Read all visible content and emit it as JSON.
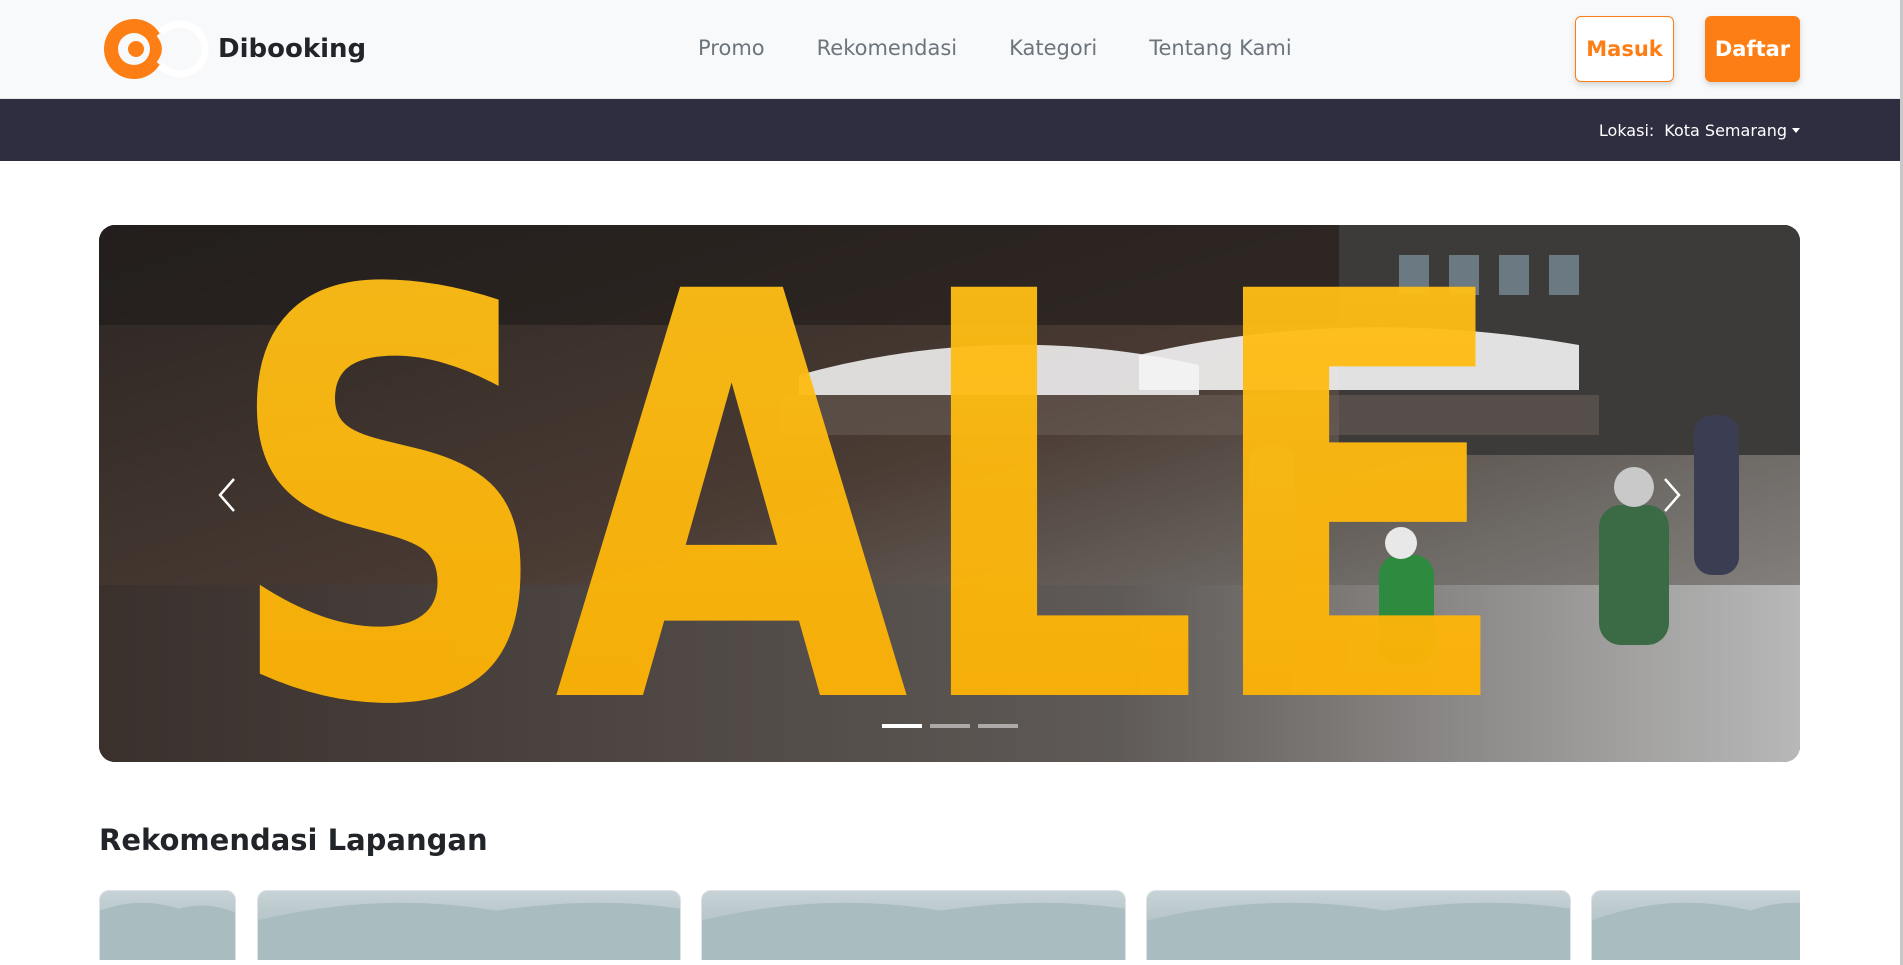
{
  "brand": {
    "name": "Dibooking",
    "logo_icon": "dibooking-logo",
    "accent_color": "#fd7e14"
  },
  "nav": {
    "links": [
      {
        "label": "Promo"
      },
      {
        "label": "Rekomendasi"
      },
      {
        "label": "Kategori"
      },
      {
        "label": "Tentang Kami"
      }
    ],
    "login_label": "Masuk",
    "register_label": "Daftar"
  },
  "location_bar": {
    "label": "Lokasi:",
    "value": "Kota Semarang",
    "background_color": "#2f2e41"
  },
  "carousel": {
    "slide_text": "SALE",
    "prev_icon": "chevron-left-icon",
    "next_icon": "chevron-right-icon",
    "indicator_count": 3,
    "active_index": 0
  },
  "recommendation": {
    "title": "Rekomendasi Lapangan",
    "card_count": 5
  }
}
